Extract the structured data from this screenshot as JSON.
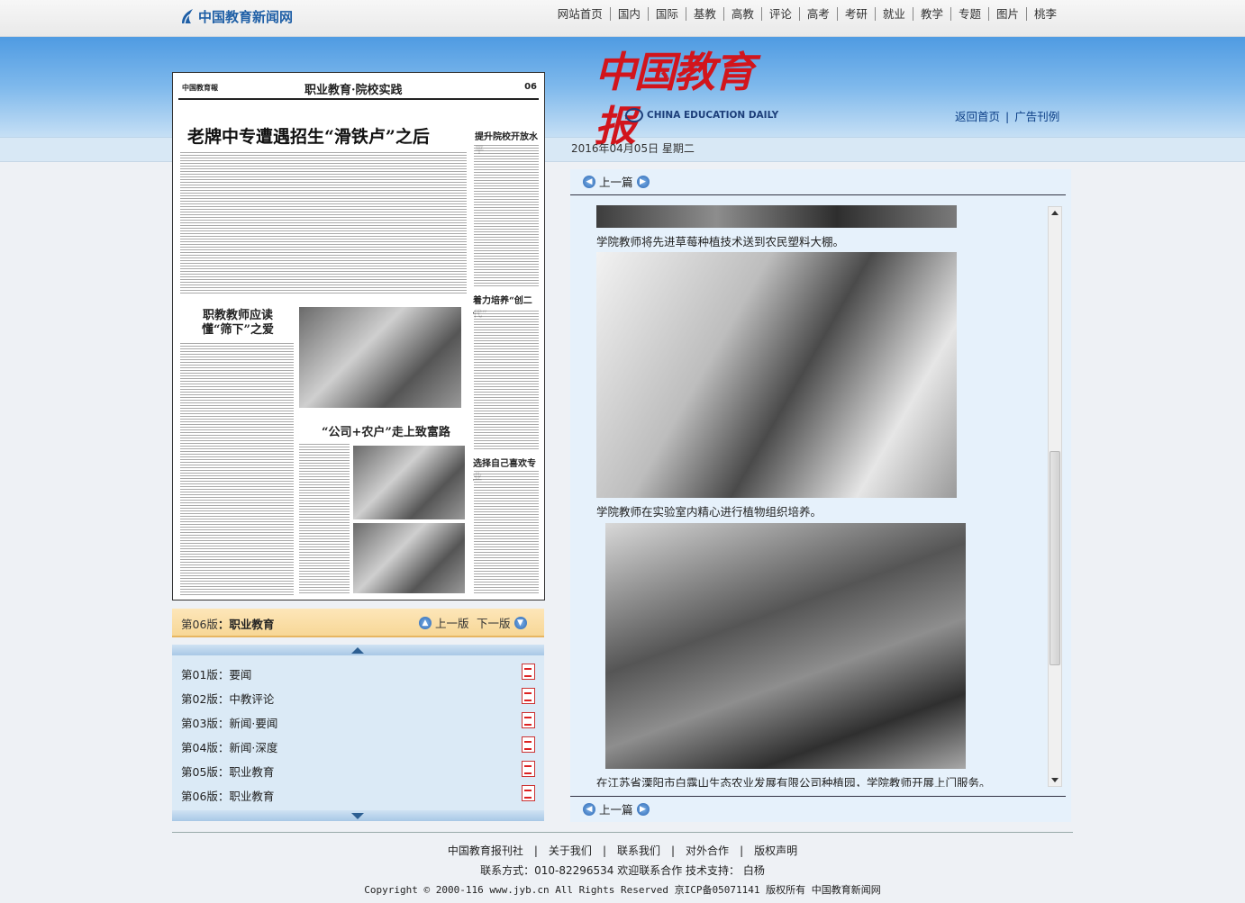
{
  "site": {
    "logo_text": "中国教育新闻网"
  },
  "nav": [
    "网站首页",
    "国内",
    "国际",
    "基教",
    "高教",
    "评论",
    "高考",
    "考研",
    "就业",
    "教学",
    "专题",
    "图片",
    "桃李"
  ],
  "masthead": {
    "title": "中国教育报",
    "subtitle": "CHINA EDUCATION DAILY"
  },
  "top_links": {
    "home": "返回首页",
    "ads": "广告刊例"
  },
  "date": "2016年04月05日  星期二",
  "newspaper": {
    "paper_name": "中国教育報",
    "section_title": "职业教育·院校实践",
    "page_no": "06",
    "headline": "老牌中专遭遇招生“滑铁卢”之后",
    "side_headline": "提升院校开放水平",
    "headline2": "职教教师应读懂“筛下”之爱",
    "headline3": "“公司+农户”走上致富路",
    "headline4": "着力培养“创二代”",
    "headline5": "选择自己喜欢专业"
  },
  "page_bar": {
    "current_prefix": "第06版",
    "current_name": "职业教育",
    "prev": "上一版",
    "next": "下一版"
  },
  "page_list": [
    {
      "no": "第01版",
      "name": "要闻"
    },
    {
      "no": "第02版",
      "name": "中教评论"
    },
    {
      "no": "第03版",
      "name": "新闻·要闻"
    },
    {
      "no": "第04版",
      "name": "新闻·深度"
    },
    {
      "no": "第05版",
      "name": "职业教育"
    },
    {
      "no": "第06版",
      "name": "职业教育"
    }
  ],
  "article": {
    "prev_top": "上一篇",
    "prev_bottom": "上一篇",
    "captions": [
      "学院教师将先进草莓种植技术送到农民塑料大棚。",
      "学院教师在实验室内精心进行植物组织培养。",
      "在江苏省溧阳市白露山生态农业发展有限公司种植园，学院教师开展上门服务。"
    ]
  },
  "footer": {
    "links": [
      "中国教育报刊社",
      "关于我们",
      "联系我们",
      "对外合作",
      "版权声明"
    ],
    "contact": "联系方式：010-82296534 欢迎联系合作 技术支持： 白杨",
    "copyright": "Copyright © 2000-116 www.jyb.cn All Rights Reserved 京ICP备05071141 版权所有 中国教育新闻网"
  },
  "colors": {
    "brand_red": "#d2151c",
    "link_blue": "#0d3f86",
    "band_blue": "#4f9be2"
  }
}
